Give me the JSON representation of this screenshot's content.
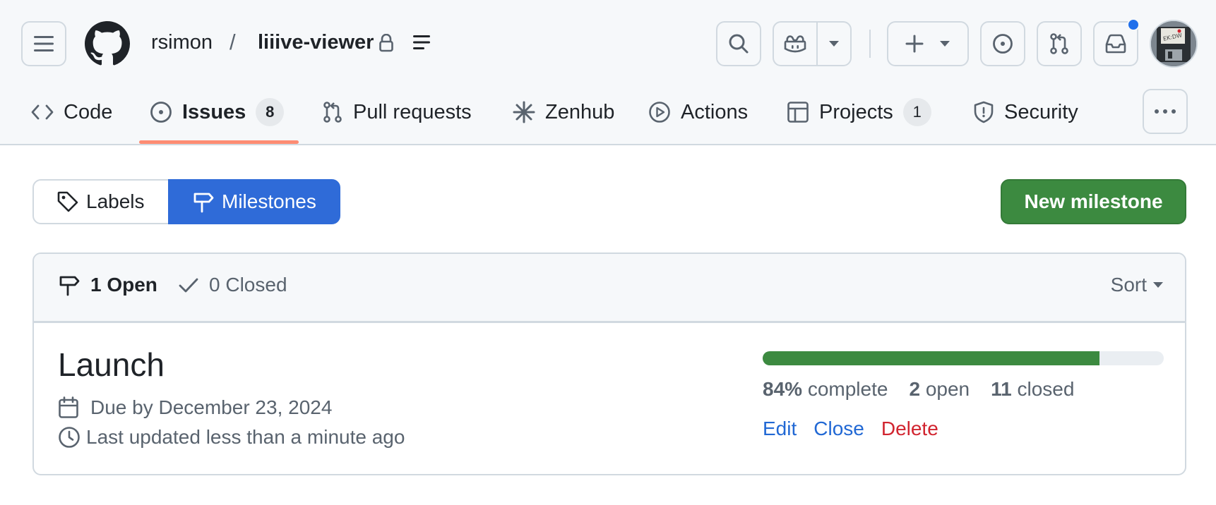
{
  "header": {
    "owner": "rsimon",
    "separator": "/",
    "repo": "liiive-viewer",
    "has_notification": true,
    "accent_color": "#1f6feb"
  },
  "icons": {
    "menu": "hamburger-icon",
    "logo": "github-mark-icon",
    "lock": "lock-icon",
    "repo_menu": "repo-menu-icon",
    "search": "search-icon",
    "copilot": "copilot-icon",
    "create": "plus-icon",
    "issues": "issue-opened-icon",
    "pull_requests": "git-pull-request-icon",
    "inbox": "inbox-icon"
  },
  "tabs": [
    {
      "label": "Code",
      "icon": "code-icon"
    },
    {
      "label": "Issues",
      "icon": "issue-opened-icon",
      "count": "8",
      "selected": true
    },
    {
      "label": "Pull requests",
      "icon": "git-pull-request-icon"
    },
    {
      "label": "Zenhub",
      "icon": "zenhub-icon"
    },
    {
      "label": "Actions",
      "icon": "play-icon"
    },
    {
      "label": "Projects",
      "icon": "table-icon",
      "count": "1"
    },
    {
      "label": "Security",
      "icon": "shield-icon"
    }
  ],
  "subnav": {
    "labels": "Labels",
    "milestones": "Milestones",
    "selected": "Milestones",
    "selected_color": "#2f6bd8"
  },
  "new_milestone_label": "New milestone",
  "new_milestone_color": "#3c8a40",
  "filter": {
    "open_label": "1 Open",
    "closed_label": "0 Closed",
    "sort_label": "Sort"
  },
  "milestone": {
    "title": "Launch",
    "due": "Due by December 23, 2024",
    "updated": "Last updated less than a minute ago",
    "progress_percent": 84,
    "percent_label": "84%",
    "complete_label": "complete",
    "open_count": "2",
    "open_label": "open",
    "closed_count": "11",
    "closed_label": "closed",
    "edit_label": "Edit",
    "close_label": "Close",
    "delete_label": "Delete"
  }
}
